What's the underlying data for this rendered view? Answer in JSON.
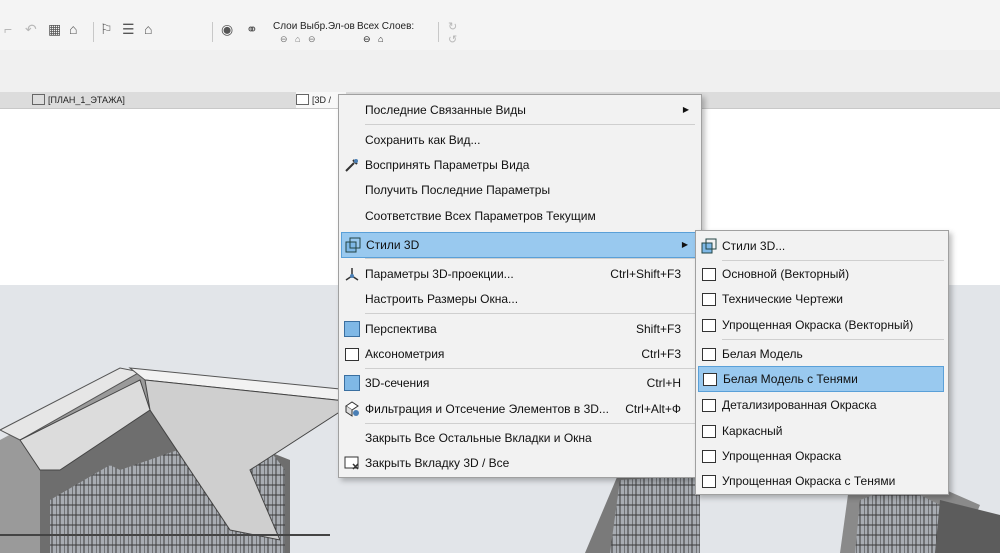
{
  "toolbar": {
    "layers_label": "Слои",
    "selected_label": "Выбр.Эл-ов",
    "all_layers_label": "Всех Слоев:"
  },
  "tabs": [
    {
      "label": "[ПЛАН_1_ЭТАЖА]"
    },
    {
      "label": "[3D /"
    }
  ],
  "context_menu": {
    "items": [
      {
        "label": "Последние Связанные Виды",
        "shortcut": "",
        "submenu": true
      },
      {
        "label": "Сохранить как Вид...",
        "shortcut": ""
      },
      {
        "label": "Воспринять Параметры Вида",
        "shortcut": "",
        "icon": "eyedropper-icon"
      },
      {
        "label": "Получить Последние Параметры",
        "shortcut": ""
      },
      {
        "label": "Соответствие Всех Параметров Текущим",
        "shortcut": ""
      },
      {
        "label": "Стили 3D",
        "shortcut": "",
        "submenu": true,
        "highlighted": true,
        "icon": "3d-styles-icon"
      },
      {
        "label": "Параметры 3D-проекции...",
        "shortcut": "Ctrl+Shift+F3",
        "icon": "projection-icon"
      },
      {
        "label": "Настроить Размеры Окна...",
        "shortcut": ""
      },
      {
        "label": "Перспектива",
        "shortcut": "Shift+F3",
        "icon": "perspective-icon"
      },
      {
        "label": "Аксонометрия",
        "shortcut": "Ctrl+F3",
        "icon": "axonometry-icon"
      },
      {
        "label": "3D-сечения",
        "shortcut": "Ctrl+H",
        "icon": "3d-section-icon"
      },
      {
        "label": "Фильтрация и Отсечение Элементов в 3D...",
        "shortcut": "Ctrl+Alt+Ф",
        "icon": "filter-cut-icon"
      },
      {
        "label": "Закрыть Все Остальные Вкладки и Окна",
        "shortcut": ""
      },
      {
        "label": "Закрыть Вкладку 3D / Все",
        "shortcut": "",
        "icon": "close-tab-icon"
      }
    ]
  },
  "submenu": {
    "items": [
      {
        "label": "Стили 3D...",
        "icon": "3d-styles-icon"
      },
      {
        "label": "Основной (Векторный)",
        "icon": "render-style-icon"
      },
      {
        "label": "Технические Чертежи",
        "icon": "render-style-icon"
      },
      {
        "label": "Упрощенная Окраска (Векторный)",
        "icon": "render-style-icon"
      },
      {
        "label": "Белая Модель",
        "icon": "render-style-icon"
      },
      {
        "label": "Белая Модель с Тенями",
        "icon": "render-style-icon",
        "highlighted": true
      },
      {
        "label": "Детализированная Окраска",
        "icon": "render-style-icon"
      },
      {
        "label": "Каркасный",
        "icon": "render-style-icon"
      },
      {
        "label": "Упрощенная Окраска",
        "icon": "render-style-icon"
      },
      {
        "label": "Упрощенная Окраска с Тенями",
        "icon": "render-style-icon"
      }
    ]
  },
  "colors": {
    "highlight": "#99c9ef",
    "highlight_border": "#5aa0d8",
    "menu_bg": "#f2f2f2",
    "ground": "#e2e5e9"
  }
}
